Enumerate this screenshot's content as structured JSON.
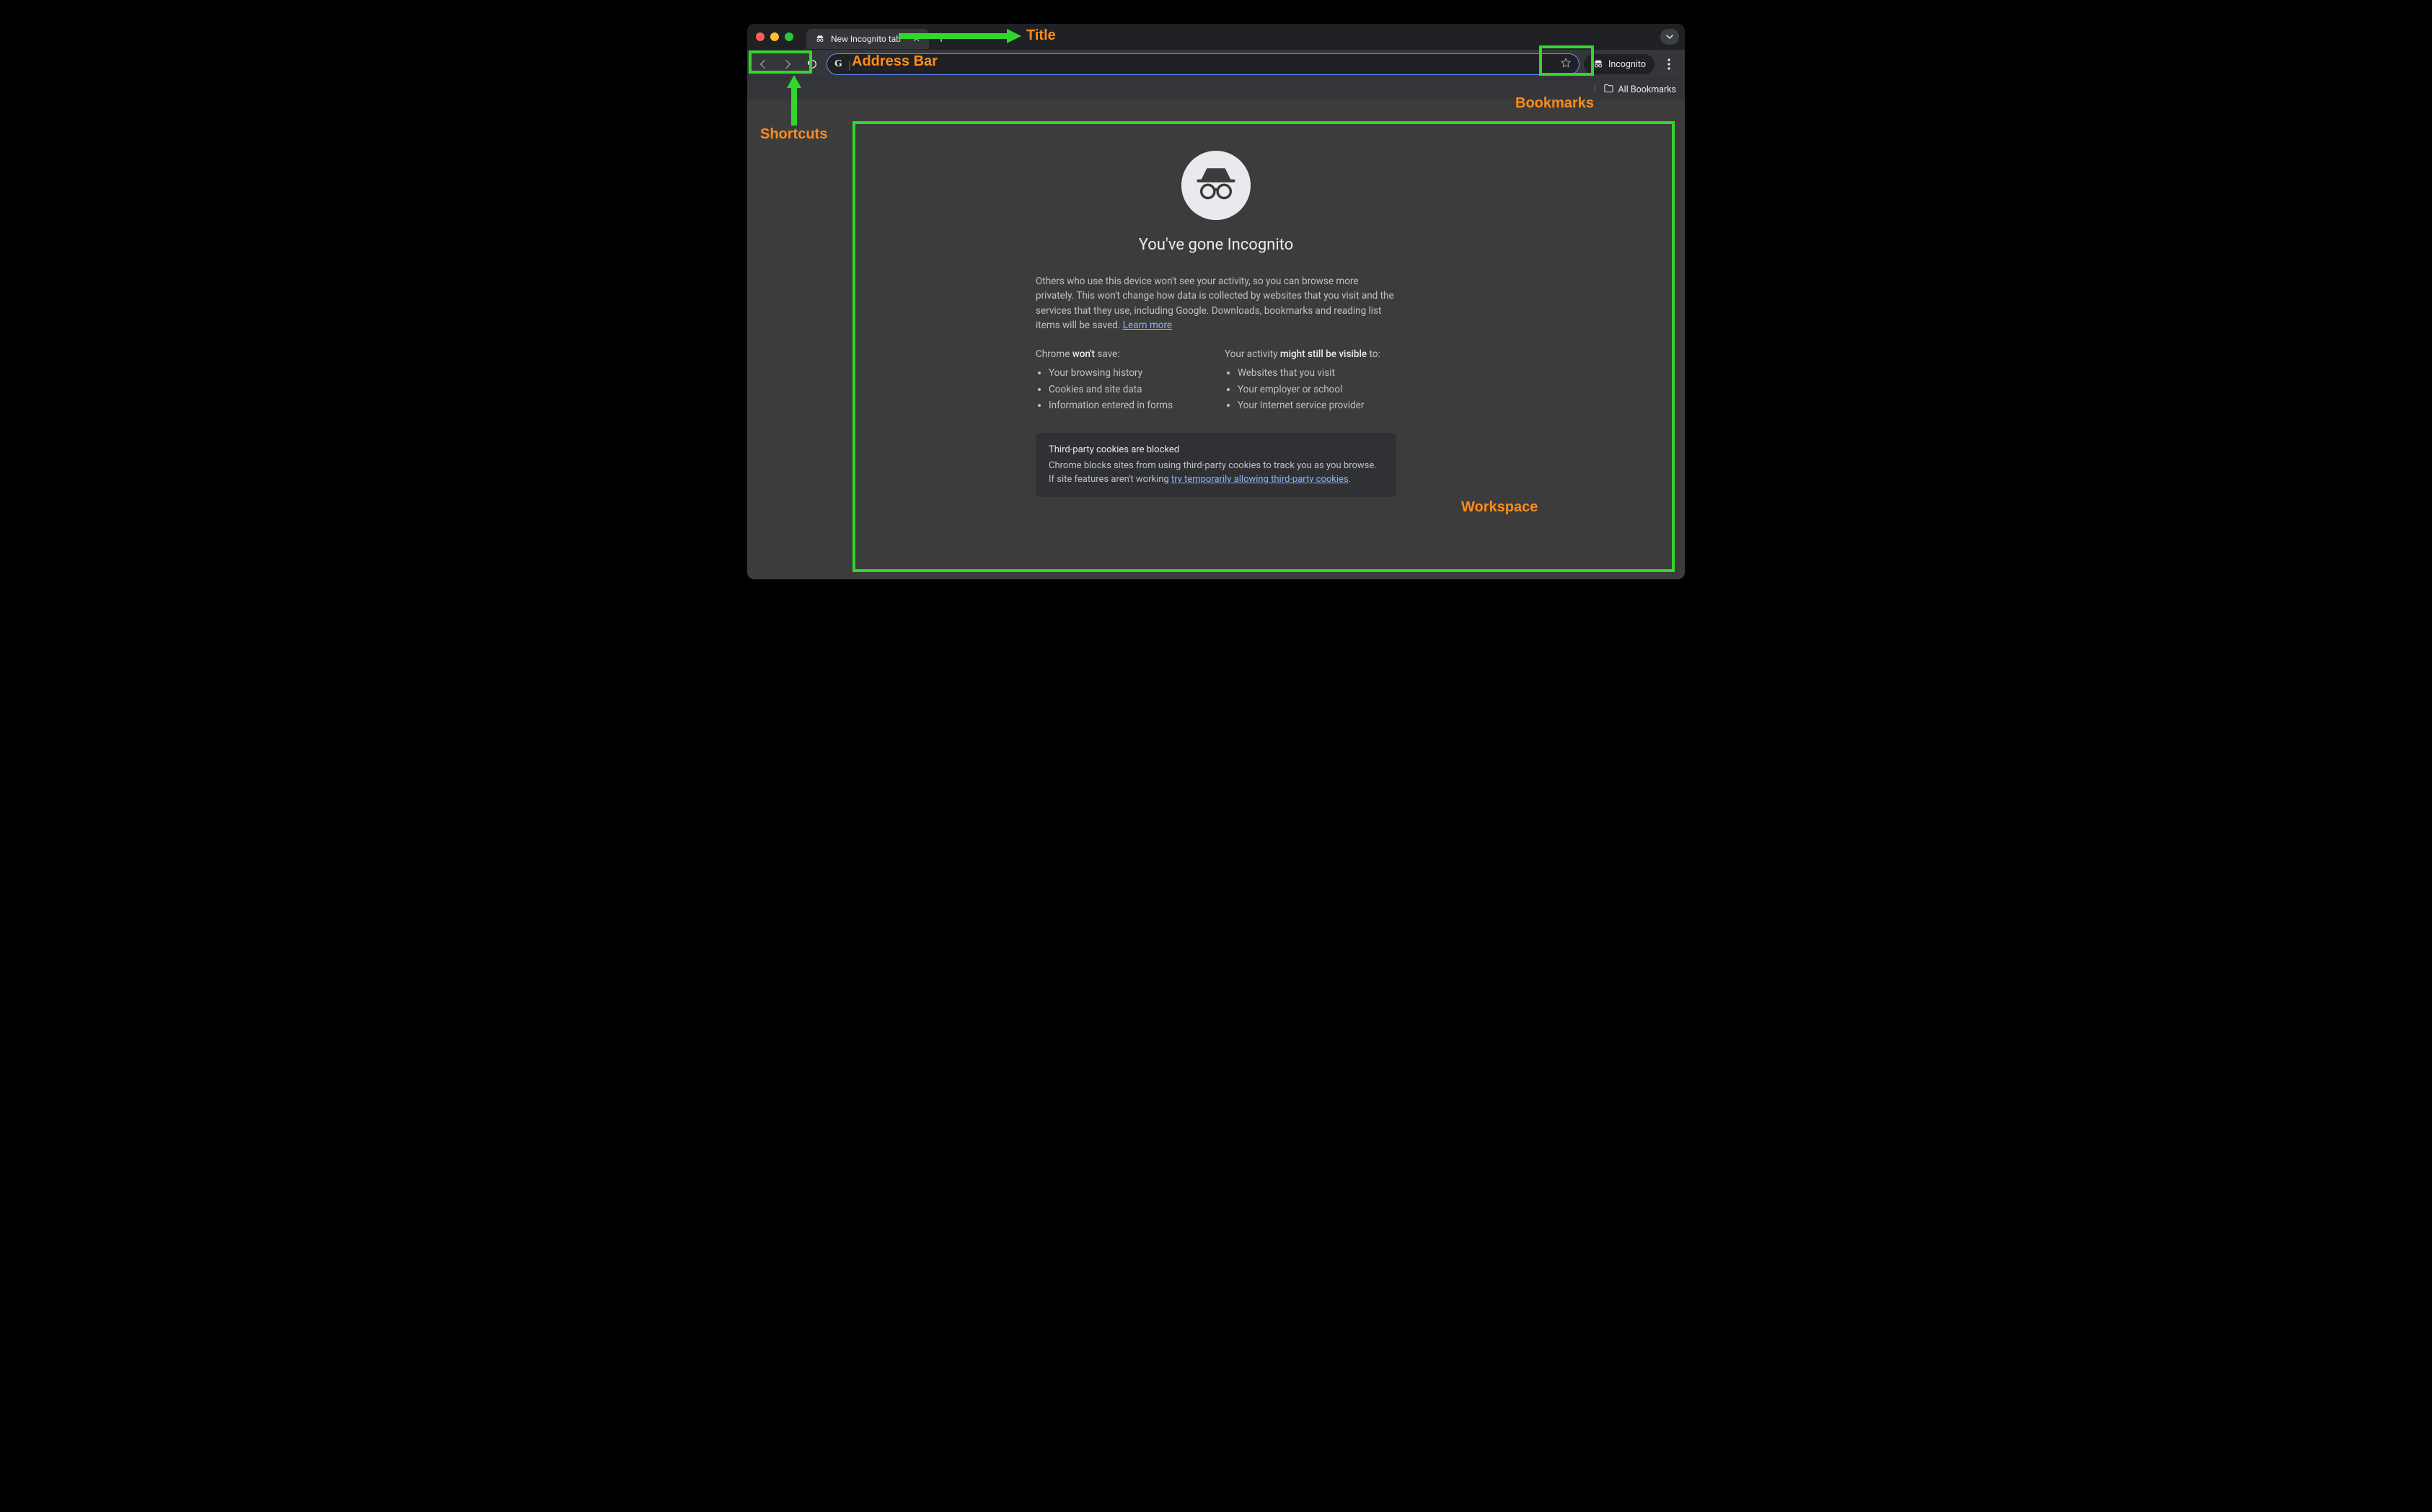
{
  "window": {
    "tab_title": "New Incognito tab"
  },
  "toolbar": {
    "search_engine_letter": "G",
    "incognito_chip": "Incognito"
  },
  "bookmarks": {
    "all_bookmarks": "All Bookmarks"
  },
  "page": {
    "hero_title": "You've gone Incognito",
    "description_pre": "Others who use this device won't see your activity, so you can browse more privately. This won't change how data is collected by websites that you visit and the services that they use, including Google. Downloads, bookmarks and reading list items will be saved. ",
    "learn_more": "Learn more",
    "left": {
      "lead_a": "Chrome ",
      "lead_b": "won't",
      "lead_c": " save:",
      "items": [
        "Your browsing history",
        "Cookies and site data",
        "Information entered in forms"
      ]
    },
    "right": {
      "lead_a": "Your activity ",
      "lead_b": "might still be visible",
      "lead_c": " to:",
      "items": [
        "Websites that you visit",
        "Your employer or school",
        "Your Internet service provider"
      ]
    },
    "cookies": {
      "title": "Third-party cookies are blocked",
      "line1": "Chrome blocks sites from using third-party cookies to track you as you browse.",
      "line2_pre": "If site features aren't working ",
      "line2_link": "try temporarily allowing third-party cookies",
      "line2_post": "."
    }
  },
  "annotations": {
    "title": "Title",
    "address_bar": "Address Bar",
    "shortcuts": "Shortcuts",
    "bookmarks": "Bookmarks",
    "workspace": "Workspace"
  }
}
